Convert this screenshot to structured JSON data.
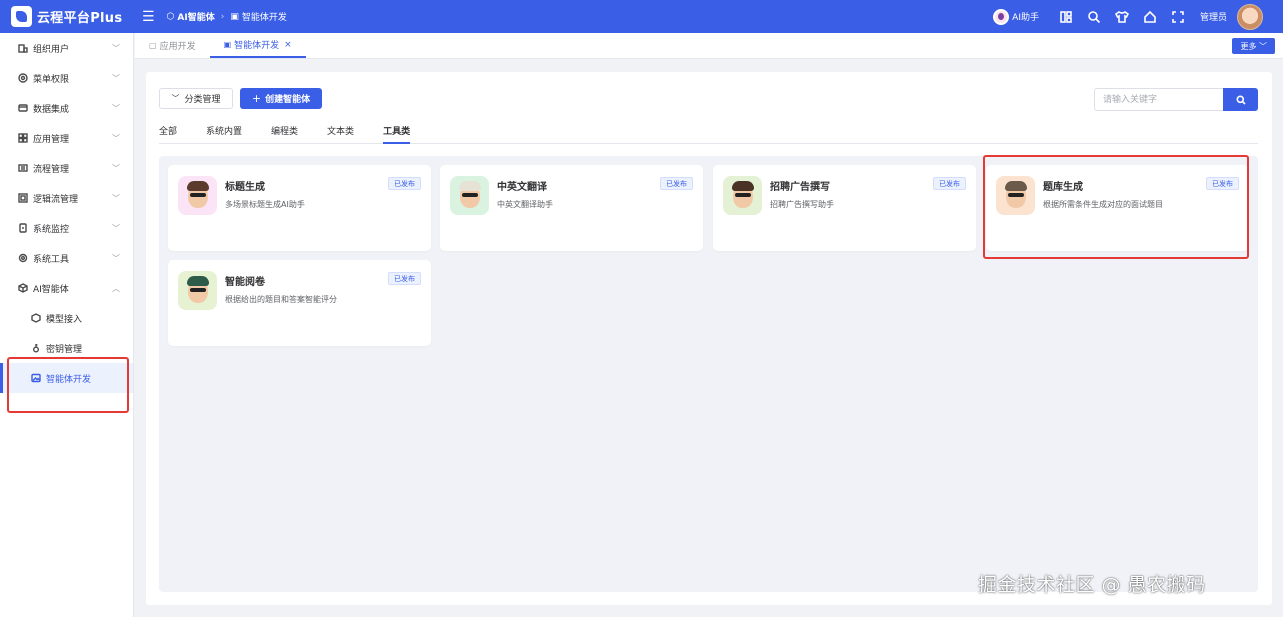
{
  "header": {
    "logo_text": "云程平台Plus",
    "breadcrumb": [
      "AI智能体",
      "智能体开发"
    ],
    "ai_helper": "AI助手",
    "user_name": "管理员",
    "icons": [
      "layout-icon",
      "search-icon",
      "shirt-icon",
      "home-icon",
      "fullscreen-icon"
    ]
  },
  "sidebar": {
    "items": [
      {
        "label": "组织用户",
        "icon": "org-icon",
        "arrow": "﹀"
      },
      {
        "label": "菜单权限",
        "icon": "menu-icon",
        "arrow": "﹀"
      },
      {
        "label": "数据集成",
        "icon": "data-icon",
        "arrow": "﹀"
      },
      {
        "label": "应用管理",
        "icon": "app-icon",
        "arrow": "﹀"
      },
      {
        "label": "流程管理",
        "icon": "flow-icon",
        "arrow": "﹀"
      },
      {
        "label": "逻辑流管理",
        "icon": "logic-icon",
        "arrow": "﹀"
      },
      {
        "label": "系统监控",
        "icon": "monitor-icon",
        "arrow": "﹀"
      },
      {
        "label": "系统工具",
        "icon": "tool-icon",
        "arrow": "﹀"
      },
      {
        "label": "AI智能体",
        "icon": "ai-icon",
        "arrow": "︿"
      }
    ],
    "sub_items": [
      {
        "label": "模型接入",
        "icon": "model-icon"
      },
      {
        "label": "密钥管理",
        "icon": "key-icon"
      },
      {
        "label": "智能体开发",
        "icon": "image-icon"
      }
    ]
  },
  "tabs": {
    "items": [
      {
        "label": "应用开发"
      },
      {
        "label": "智能体开发",
        "close": "×"
      }
    ],
    "more_label": "更多 ﹀"
  },
  "toolbar": {
    "category_label": "分类管理",
    "create_label": "创建智能体",
    "search_placeholder": "请输入关键字"
  },
  "categories": [
    "全部",
    "系统内置",
    "编程类",
    "文本类",
    "工具类"
  ],
  "active_category": "工具类",
  "cards": [
    {
      "title": "标题生成",
      "desc": "多场景标题生成AI助手",
      "badge": "已发布",
      "bg": "#fbe4f5",
      "hair": "#5a3b2c"
    },
    {
      "title": "中英文翻译",
      "desc": "中英文翻译助手",
      "badge": "已发布",
      "bg": "#d9f3e0",
      "hair": "#e7e2d6"
    },
    {
      "title": "招聘广告撰写",
      "desc": "招聘广告撰写助手",
      "badge": "已发布",
      "bg": "#e4f1d4",
      "hair": "#4a3226"
    },
    {
      "title": "题库生成",
      "desc": "根据所需条件生成对应的面试题目",
      "badge": "已发布",
      "bg": "#fbe3d0",
      "hair": "#6b5a4a"
    },
    {
      "title": "智能阅卷",
      "desc": "根据给出的题目和答案智能评分",
      "badge": "已发布",
      "bg": "#e6f2d2",
      "hair": "#2e5b4a"
    }
  ],
  "watermark": "掘金技术社区 @ 愚农搬码",
  "colors": {
    "primary": "#3a5ee6",
    "highlight": "#e53935"
  }
}
